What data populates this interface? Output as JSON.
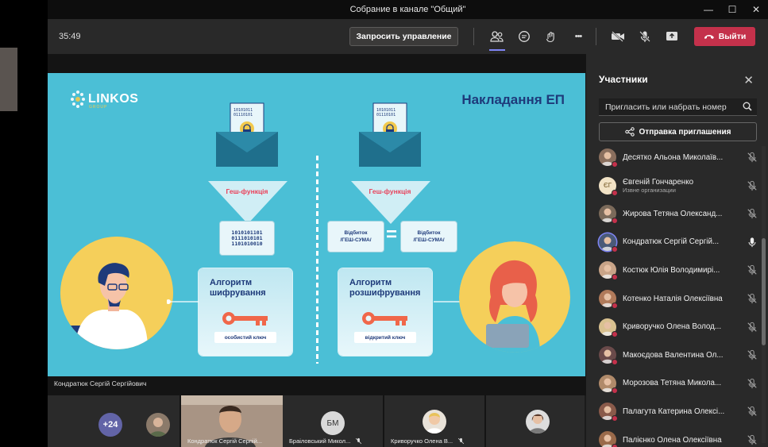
{
  "window": {
    "title": "Собрание в канале \"Общий\"",
    "controls": [
      "—",
      "☐",
      "✕"
    ]
  },
  "toolbar": {
    "timer": "35:49",
    "request_control_label": "Запросить управление",
    "leave_label": "Выйти",
    "more_label": "•••",
    "accent_color": "#c4314b"
  },
  "slide": {
    "logo_text": "LINKOS",
    "logo_sub": "GROUP",
    "title": "Накладання ЕП",
    "left": {
      "hash_label": "Геш-функція",
      "binary": "1010101101\n0111010101\n1101010010",
      "algo_title_1": "Алгоритм",
      "algo_title_2": "шифрування",
      "key_label": "особистий ключ"
    },
    "right": {
      "hash_label": "Геш-функція",
      "hash_box_1": "Відбиток\n/ГЕШ-СУМА/",
      "hash_box_2": "Відбиток\n/ГЕШ-СУМА/",
      "equals": "=",
      "algo_title_1": "Алгоритм",
      "algo_title_2": "розшифрування",
      "key_label": "відкритий ключ"
    },
    "background_color": "#4bbfd6"
  },
  "presenter_name": "Кондратюк Сергій Сергійович",
  "gallery": {
    "more_count": "+24",
    "tiles": [
      {
        "name": "Кондратюк Сергій Серпій..."
      },
      {
        "name": "Браіловський Микол...",
        "initials": "БМ"
      },
      {
        "name": "Криворучко Олена В..."
      }
    ]
  },
  "participants_panel": {
    "title": "Участники",
    "invite_placeholder": "Пригласить или набрать номер",
    "share_invite_label": "Отправка приглашения",
    "items": [
      {
        "name": "Десятко Альона Миколаїв...",
        "sub": "",
        "mic": "muted"
      },
      {
        "name": "Євгеній Гончаренко",
        "sub": "Извне организации",
        "initials": "ЄГ",
        "mic": "muted"
      },
      {
        "name": "Жирова Тетяна Олександ...",
        "sub": "",
        "mic": "muted"
      },
      {
        "name": "Кондратюк Сергій Сергій...",
        "sub": "",
        "mic": "on"
      },
      {
        "name": "Костюк Юлія Володимирі...",
        "sub": "",
        "mic": "muted"
      },
      {
        "name": "Котенко Наталія Олексіївна",
        "sub": "",
        "mic": "muted"
      },
      {
        "name": "Криворучко Олена Волод...",
        "sub": "",
        "mic": "muted"
      },
      {
        "name": "Макоєдова Валентина Ол...",
        "sub": "",
        "mic": "muted"
      },
      {
        "name": "Морозова Тетяна Микола...",
        "sub": "",
        "mic": "muted"
      },
      {
        "name": "Палагута Катерина Олексі...",
        "sub": "",
        "mic": "muted"
      },
      {
        "name": "Палієнко Олена Олексіївна",
        "sub": "",
        "mic": "muted"
      }
    ]
  }
}
